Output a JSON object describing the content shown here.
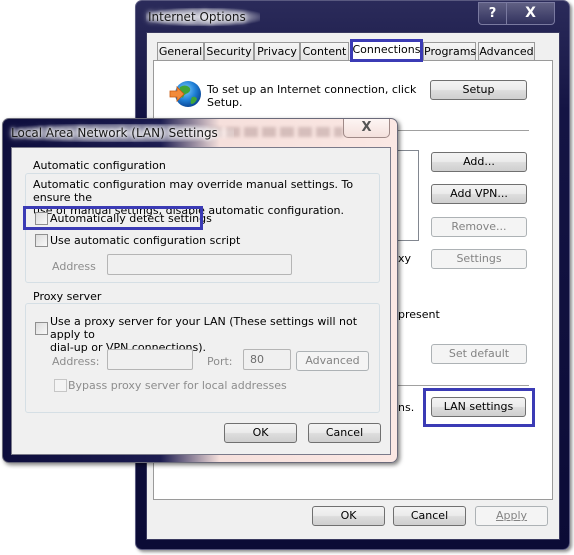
{
  "internet_options": {
    "title": "Internet Options",
    "help_button": "?",
    "close_button": "X",
    "tabs": [
      {
        "label": "General",
        "active": false
      },
      {
        "label": "Security",
        "active": false
      },
      {
        "label": "Privacy",
        "active": false
      },
      {
        "label": "Content",
        "active": false
      },
      {
        "label": "Connections",
        "active": true
      },
      {
        "label": "Programs",
        "active": false
      },
      {
        "label": "Advanced",
        "active": false
      }
    ],
    "connections": {
      "setup_text_line1": "To set up an Internet connection, click",
      "setup_text_line2": "Setup.",
      "setup_button": "Setup",
      "add_button": "Add...",
      "add_vpn_button": "Add VPN...",
      "remove_button": "Remove...",
      "settings_button": "Settings",
      "partial_text_proxy": "xy",
      "partial_text_present": "present",
      "set_default_button": "Set default",
      "partial_text_lan": "ns.",
      "lan_settings_button": "LAN settings"
    },
    "footer": {
      "ok": "OK",
      "cancel": "Cancel",
      "apply": "Apply"
    }
  },
  "lan_dialog": {
    "title": "Local Area Network (LAN) Settings",
    "close_button": "X",
    "automatic_configuration": {
      "group_label": "Automatic configuration",
      "description_line1": "Automatic configuration may override manual settings.  To ensure the",
      "description_line2": "use of manual settings, disable automatic configuration.",
      "auto_detect_label": "Automatically detect settings",
      "auto_detect_checked": false,
      "use_script_label": "Use automatic configuration script",
      "use_script_checked": false,
      "address_label": "Address",
      "address_value": ""
    },
    "proxy_server": {
      "group_label": "Proxy server",
      "use_proxy_line1": "Use a proxy server for your LAN (These settings will not apply to",
      "use_proxy_line2": "dial-up or VPN connections).",
      "use_proxy_checked": false,
      "address_label": "Address:",
      "address_value": "",
      "port_label": "Port:",
      "port_value": "80",
      "advanced_button": "Advanced",
      "bypass_label": "Bypass proxy server for local addresses",
      "bypass_checked": false
    },
    "ok": "OK",
    "cancel": "Cancel"
  },
  "colors": {
    "highlight": "#3b3bb5",
    "frame": "#0b0b36",
    "dialog_bg": "#f0f0f0"
  }
}
